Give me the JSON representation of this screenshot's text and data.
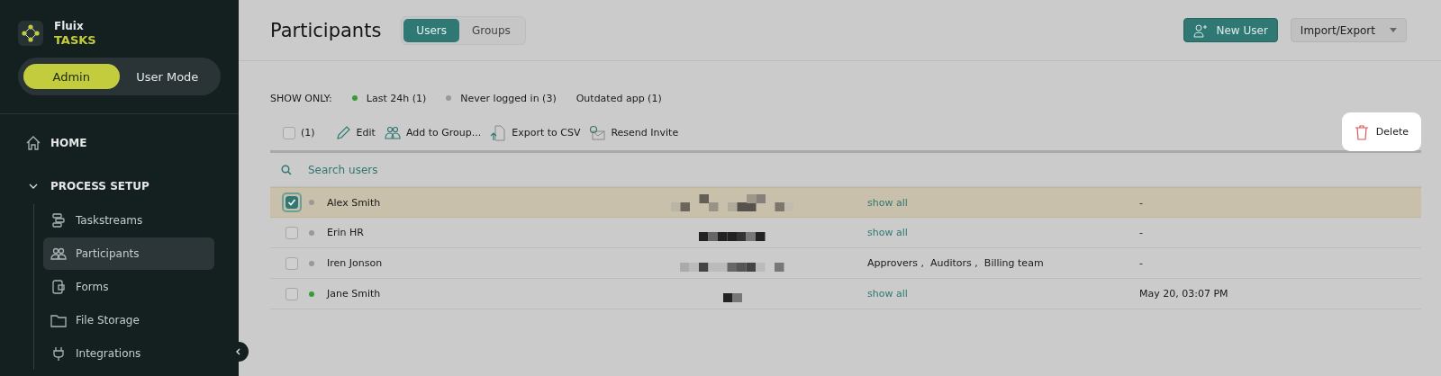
{
  "brand": {
    "name": "Fluix",
    "product": "TASKS"
  },
  "mode_toggle": [
    {
      "label": "Admin",
      "selected": true
    },
    {
      "label": "User Mode",
      "selected": false
    }
  ],
  "sidebar": {
    "items": [
      {
        "label": "HOME",
        "kind": "top"
      },
      {
        "label": "PROCESS SETUP",
        "kind": "section",
        "expanded": true,
        "children": [
          {
            "label": "Taskstreams",
            "selected": false
          },
          {
            "label": "Participants",
            "selected": true
          },
          {
            "label": "Forms",
            "selected": false
          },
          {
            "label": "File Storage",
            "selected": false
          },
          {
            "label": "Integrations",
            "selected": false
          }
        ]
      }
    ]
  },
  "header": {
    "title": "Participants",
    "tabs": [
      {
        "label": "Users",
        "selected": true
      },
      {
        "label": "Groups",
        "selected": false
      }
    ],
    "new_user": "New User",
    "import_export": "Import/Export"
  },
  "filters": {
    "label": "SHOW ONLY:",
    "items": [
      {
        "label": "Last 24h (1)",
        "color": "#3a9a3a"
      },
      {
        "label": "Never logged in (3)",
        "color": "#999999"
      },
      {
        "label": "Outdated app (1)"
      }
    ]
  },
  "toolbar": {
    "select_all": {
      "checked": false,
      "count": "(1)"
    },
    "actions": [
      {
        "label": "Edit"
      },
      {
        "label": "Add to Group..."
      },
      {
        "label": "Export to CSV"
      },
      {
        "label": "Resend Invite"
      }
    ],
    "delete": "Delete"
  },
  "search": {
    "placeholder": "Search users"
  },
  "rows": [
    {
      "name": "Alex Smith",
      "selected": true,
      "checked": true,
      "color": "#999999",
      "groups": {
        "kind": "link",
        "text": "show all"
      },
      "last_seen": "-"
    },
    {
      "name": "Erin HR",
      "selected": false,
      "checked": false,
      "color": "#999999",
      "groups": {
        "kind": "link",
        "text": "show all"
      },
      "last_seen": "-"
    },
    {
      "name": "Iren Jonson",
      "selected": false,
      "checked": false,
      "color": "#999999",
      "groups": {
        "kind": "text",
        "text": "Approvers ,  Auditors ,  Billing team"
      },
      "last_seen": "-"
    },
    {
      "name": "Jane Smith",
      "selected": false,
      "checked": false,
      "color": "#3a9a3a",
      "groups": {
        "kind": "link",
        "text": "show all"
      },
      "last_seen": "May 20, 03:07 PM"
    }
  ]
}
